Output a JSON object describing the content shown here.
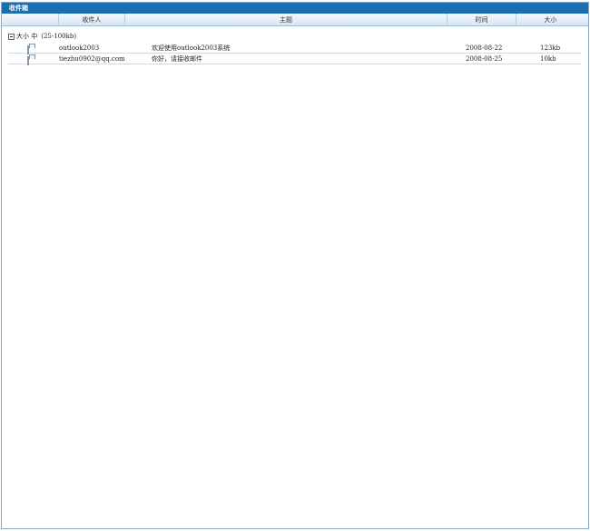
{
  "window": {
    "title": "收件箱"
  },
  "columns": [
    {
      "label": ""
    },
    {
      "label": "收件人"
    },
    {
      "label": "主题"
    },
    {
      "label": "时间"
    },
    {
      "label": "大小"
    }
  ],
  "group": {
    "label": "大小 中",
    "range": "(25-100kb)"
  },
  "rows": [
    {
      "icon": "envelope-icon",
      "sender": "outlook2003",
      "subject": "欢迎使用outlook2003系统",
      "date": "2008-08-22",
      "size": "123kb"
    },
    {
      "icon": "envelope-icon",
      "sender": "tiezhu0902@qq.com",
      "subject": "你好，请接收邮件",
      "date": "2008-08-25",
      "size": "10kb"
    }
  ]
}
